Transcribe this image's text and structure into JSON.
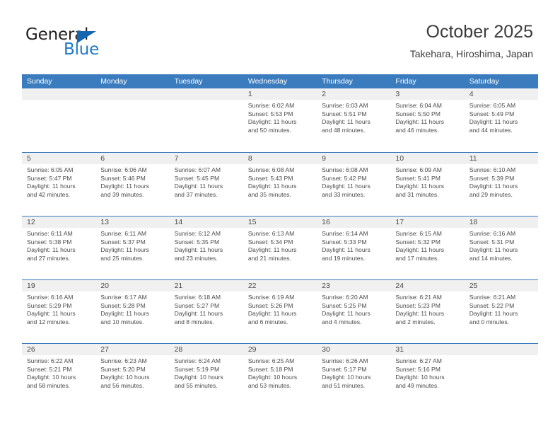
{
  "logo": {
    "word_top": "General",
    "word_bottom": "Blue",
    "triangle_color": "#1565b0",
    "blue_color": "#1f78c8"
  },
  "header": {
    "title": "October 2025",
    "subtitle": "Takehara, Hiroshima, Japan"
  },
  "theme": {
    "header_blue": "#3b7cbf",
    "daynum_band": "#f0f0f0",
    "text": "#4a4a4a"
  },
  "weekdays": [
    "Sunday",
    "Monday",
    "Tuesday",
    "Wednesday",
    "Thursday",
    "Friday",
    "Saturday"
  ],
  "weeks": [
    [
      {
        "day": "",
        "empty": true,
        "sunrise": "",
        "sunset": "",
        "daylight_line1": "",
        "daylight_line2": ""
      },
      {
        "day": "",
        "empty": true,
        "sunrise": "",
        "sunset": "",
        "daylight_line1": "",
        "daylight_line2": ""
      },
      {
        "day": "",
        "empty": true,
        "sunrise": "",
        "sunset": "",
        "daylight_line1": "",
        "daylight_line2": ""
      },
      {
        "day": "1",
        "empty": false,
        "sunrise": "Sunrise: 6:02 AM",
        "sunset": "Sunset: 5:53 PM",
        "daylight_line1": "Daylight: 11 hours",
        "daylight_line2": "and 50 minutes."
      },
      {
        "day": "2",
        "empty": false,
        "sunrise": "Sunrise: 6:03 AM",
        "sunset": "Sunset: 5:51 PM",
        "daylight_line1": "Daylight: 11 hours",
        "daylight_line2": "and 48 minutes."
      },
      {
        "day": "3",
        "empty": false,
        "sunrise": "Sunrise: 6:04 AM",
        "sunset": "Sunset: 5:50 PM",
        "daylight_line1": "Daylight: 11 hours",
        "daylight_line2": "and 46 minutes."
      },
      {
        "day": "4",
        "empty": false,
        "sunrise": "Sunrise: 6:05 AM",
        "sunset": "Sunset: 5:49 PM",
        "daylight_line1": "Daylight: 11 hours",
        "daylight_line2": "and 44 minutes."
      }
    ],
    [
      {
        "day": "5",
        "empty": false,
        "sunrise": "Sunrise: 6:05 AM",
        "sunset": "Sunset: 5:47 PM",
        "daylight_line1": "Daylight: 11 hours",
        "daylight_line2": "and 42 minutes."
      },
      {
        "day": "6",
        "empty": false,
        "sunrise": "Sunrise: 6:06 AM",
        "sunset": "Sunset: 5:46 PM",
        "daylight_line1": "Daylight: 11 hours",
        "daylight_line2": "and 39 minutes."
      },
      {
        "day": "7",
        "empty": false,
        "sunrise": "Sunrise: 6:07 AM",
        "sunset": "Sunset: 5:45 PM",
        "daylight_line1": "Daylight: 11 hours",
        "daylight_line2": "and 37 minutes."
      },
      {
        "day": "8",
        "empty": false,
        "sunrise": "Sunrise: 6:08 AM",
        "sunset": "Sunset: 5:43 PM",
        "daylight_line1": "Daylight: 11 hours",
        "daylight_line2": "and 35 minutes."
      },
      {
        "day": "9",
        "empty": false,
        "sunrise": "Sunrise: 6:08 AM",
        "sunset": "Sunset: 5:42 PM",
        "daylight_line1": "Daylight: 11 hours",
        "daylight_line2": "and 33 minutes."
      },
      {
        "day": "10",
        "empty": false,
        "sunrise": "Sunrise: 6:09 AM",
        "sunset": "Sunset: 5:41 PM",
        "daylight_line1": "Daylight: 11 hours",
        "daylight_line2": "and 31 minutes."
      },
      {
        "day": "11",
        "empty": false,
        "sunrise": "Sunrise: 6:10 AM",
        "sunset": "Sunset: 5:39 PM",
        "daylight_line1": "Daylight: 11 hours",
        "daylight_line2": "and 29 minutes."
      }
    ],
    [
      {
        "day": "12",
        "empty": false,
        "sunrise": "Sunrise: 6:11 AM",
        "sunset": "Sunset: 5:38 PM",
        "daylight_line1": "Daylight: 11 hours",
        "daylight_line2": "and 27 minutes."
      },
      {
        "day": "13",
        "empty": false,
        "sunrise": "Sunrise: 6:11 AM",
        "sunset": "Sunset: 5:37 PM",
        "daylight_line1": "Daylight: 11 hours",
        "daylight_line2": "and 25 minutes."
      },
      {
        "day": "14",
        "empty": false,
        "sunrise": "Sunrise: 6:12 AM",
        "sunset": "Sunset: 5:35 PM",
        "daylight_line1": "Daylight: 11 hours",
        "daylight_line2": "and 23 minutes."
      },
      {
        "day": "15",
        "empty": false,
        "sunrise": "Sunrise: 6:13 AM",
        "sunset": "Sunset: 5:34 PM",
        "daylight_line1": "Daylight: 11 hours",
        "daylight_line2": "and 21 minutes."
      },
      {
        "day": "16",
        "empty": false,
        "sunrise": "Sunrise: 6:14 AM",
        "sunset": "Sunset: 5:33 PM",
        "daylight_line1": "Daylight: 11 hours",
        "daylight_line2": "and 19 minutes."
      },
      {
        "day": "17",
        "empty": false,
        "sunrise": "Sunrise: 6:15 AM",
        "sunset": "Sunset: 5:32 PM",
        "daylight_line1": "Daylight: 11 hours",
        "daylight_line2": "and 17 minutes."
      },
      {
        "day": "18",
        "empty": false,
        "sunrise": "Sunrise: 6:16 AM",
        "sunset": "Sunset: 5:31 PM",
        "daylight_line1": "Daylight: 11 hours",
        "daylight_line2": "and 14 minutes."
      }
    ],
    [
      {
        "day": "19",
        "empty": false,
        "sunrise": "Sunrise: 6:16 AM",
        "sunset": "Sunset: 5:29 PM",
        "daylight_line1": "Daylight: 11 hours",
        "daylight_line2": "and 12 minutes."
      },
      {
        "day": "20",
        "empty": false,
        "sunrise": "Sunrise: 6:17 AM",
        "sunset": "Sunset: 5:28 PM",
        "daylight_line1": "Daylight: 11 hours",
        "daylight_line2": "and 10 minutes."
      },
      {
        "day": "21",
        "empty": false,
        "sunrise": "Sunrise: 6:18 AM",
        "sunset": "Sunset: 5:27 PM",
        "daylight_line1": "Daylight: 11 hours",
        "daylight_line2": "and 8 minutes."
      },
      {
        "day": "22",
        "empty": false,
        "sunrise": "Sunrise: 6:19 AM",
        "sunset": "Sunset: 5:26 PM",
        "daylight_line1": "Daylight: 11 hours",
        "daylight_line2": "and 6 minutes."
      },
      {
        "day": "23",
        "empty": false,
        "sunrise": "Sunrise: 6:20 AM",
        "sunset": "Sunset: 5:25 PM",
        "daylight_line1": "Daylight: 11 hours",
        "daylight_line2": "and 4 minutes."
      },
      {
        "day": "24",
        "empty": false,
        "sunrise": "Sunrise: 6:21 AM",
        "sunset": "Sunset: 5:23 PM",
        "daylight_line1": "Daylight: 11 hours",
        "daylight_line2": "and 2 minutes."
      },
      {
        "day": "25",
        "empty": false,
        "sunrise": "Sunrise: 6:21 AM",
        "sunset": "Sunset: 5:22 PM",
        "daylight_line1": "Daylight: 11 hours",
        "daylight_line2": "and 0 minutes."
      }
    ],
    [
      {
        "day": "26",
        "empty": false,
        "sunrise": "Sunrise: 6:22 AM",
        "sunset": "Sunset: 5:21 PM",
        "daylight_line1": "Daylight: 10 hours",
        "daylight_line2": "and 58 minutes."
      },
      {
        "day": "27",
        "empty": false,
        "sunrise": "Sunrise: 6:23 AM",
        "sunset": "Sunset: 5:20 PM",
        "daylight_line1": "Daylight: 10 hours",
        "daylight_line2": "and 56 minutes."
      },
      {
        "day": "28",
        "empty": false,
        "sunrise": "Sunrise: 6:24 AM",
        "sunset": "Sunset: 5:19 PM",
        "daylight_line1": "Daylight: 10 hours",
        "daylight_line2": "and 55 minutes."
      },
      {
        "day": "29",
        "empty": false,
        "sunrise": "Sunrise: 6:25 AM",
        "sunset": "Sunset: 5:18 PM",
        "daylight_line1": "Daylight: 10 hours",
        "daylight_line2": "and 53 minutes."
      },
      {
        "day": "30",
        "empty": false,
        "sunrise": "Sunrise: 6:26 AM",
        "sunset": "Sunset: 5:17 PM",
        "daylight_line1": "Daylight: 10 hours",
        "daylight_line2": "and 51 minutes."
      },
      {
        "day": "31",
        "empty": false,
        "sunrise": "Sunrise: 6:27 AM",
        "sunset": "Sunset: 5:16 PM",
        "daylight_line1": "Daylight: 10 hours",
        "daylight_line2": "and 49 minutes."
      },
      {
        "day": "",
        "empty": true,
        "sunrise": "",
        "sunset": "",
        "daylight_line1": "",
        "daylight_line2": ""
      }
    ]
  ]
}
